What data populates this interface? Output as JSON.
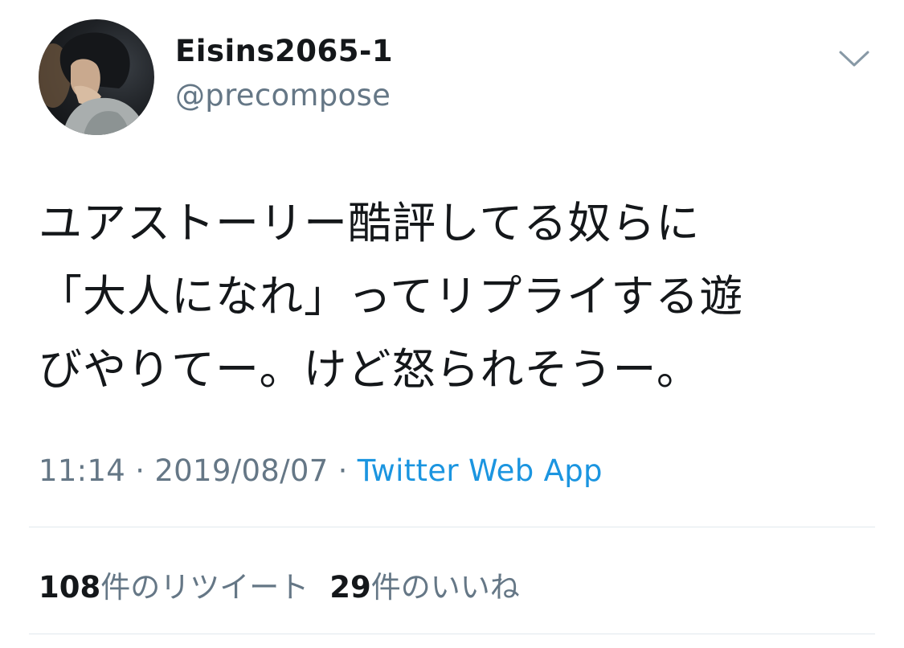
{
  "author": {
    "display_name": "Eisins2065-1",
    "handle": "@precompose",
    "avatar_icon": "profile-photo"
  },
  "menu_icon": "chevron-down-icon",
  "tweet": {
    "lines": [
      "ユアストーリー酷評してる奴らに",
      "「大人になれ」ってリプライする遊",
      "びやりてー。けど怒られそうー。"
    ]
  },
  "meta": {
    "time": "11:14",
    "separator1": " · ",
    "date": "2019/08/07",
    "separator2": " · ",
    "source": "Twitter Web App"
  },
  "stats": {
    "retweets_count": "108",
    "retweets_label": "件のリツイート",
    "likes_count": "29",
    "likes_label": "件のいいね"
  },
  "colors": {
    "text": "#14171a",
    "secondary": "#657786",
    "link": "#1b95e0",
    "divider": "#e1e8ed"
  }
}
